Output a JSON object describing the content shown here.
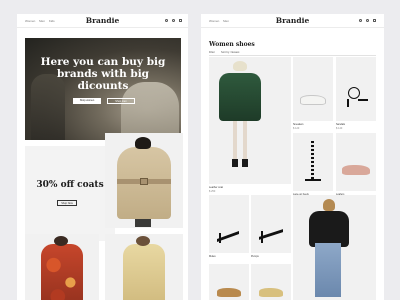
{
  "colors": {
    "background": "#ececef",
    "panel": "#ffffff",
    "text": "#222222"
  },
  "left": {
    "brand": "Brandie",
    "nav": [
      "Women",
      "Men",
      "Kids"
    ],
    "hero": {
      "title": "Here you can buy big\nbrands with big\ndicounts",
      "button_primary": "Shop women",
      "button_secondary": "Shop men"
    },
    "promo": {
      "title": "30% off coats",
      "button": "Shop Now"
    }
  },
  "right": {
    "brand": "Brandie",
    "nav": [
      "Women",
      "Men"
    ],
    "page_title": "Women shoes",
    "filters": [
      "Filter",
      "Sort by: Newest"
    ],
    "products": [
      {
        "name": "Leather coat",
        "price": "$ 250"
      },
      {
        "name": "Sneakers",
        "price": "$ 120"
      },
      {
        "name": "Sandals",
        "price": "$ 140"
      },
      {
        "name": "Lace-up heels",
        "price": "$ 180"
      },
      {
        "name": "Loafers",
        "price": "$ 110"
      },
      {
        "name": "Mules",
        "price": "$ 130"
      },
      {
        "name": "Pumps",
        "price": "$ 160"
      }
    ]
  }
}
